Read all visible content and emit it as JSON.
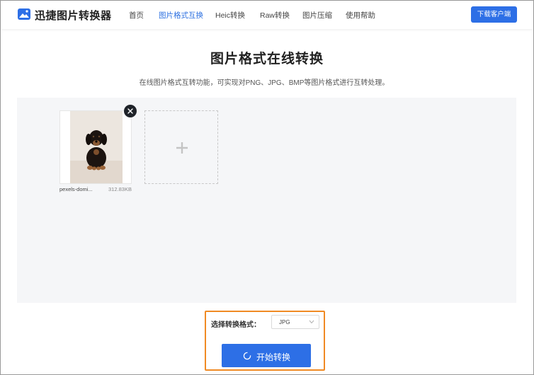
{
  "header": {
    "brand": "迅捷图片转换器",
    "logo_icon": "image-landscape-icon",
    "nav": [
      {
        "label": "首页",
        "active": false
      },
      {
        "label": "图片格式互换",
        "active": true
      },
      {
        "label": "Heic转换",
        "active": false
      },
      {
        "label": "Raw转换",
        "active": false
      },
      {
        "label": "图片压缩",
        "active": false
      },
      {
        "label": "使用帮助",
        "active": false
      }
    ],
    "download_button": "下载客户端"
  },
  "main": {
    "title": "图片格式在线转换",
    "subtitle": "在线图片格式互转功能，可实现对PNG、JPG、BMP等图片格式进行互转处理。"
  },
  "upload": {
    "file": {
      "name": "pexels-domi...",
      "size": "312.83KB",
      "remove_icon": "close-icon"
    },
    "add_icon": "plus-icon"
  },
  "controls": {
    "format_label": "选择转换格式：",
    "format_value": "JPG",
    "start_button": "开始转换",
    "start_icon": "spinner-icon"
  },
  "colors": {
    "primary": "#2d6fe6",
    "highlight": "#f08a24",
    "active_nav": "#2b6fe0"
  }
}
